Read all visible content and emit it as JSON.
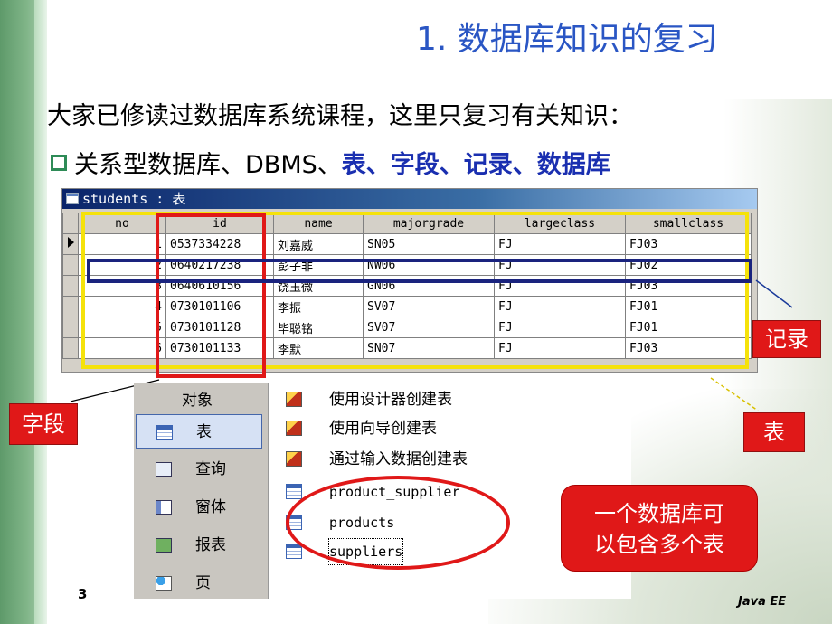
{
  "slide": {
    "title": "1. 数据库知识的复习",
    "intro": "大家已修读过数据库系统课程，这里只复习有关知识：",
    "bullet_plain": "关系型数据库、DBMS、",
    "bullet_highlight": "表、字段、记录、数据库",
    "page_number": "3",
    "footer": "Java EE"
  },
  "table_window": {
    "title": "students : 表",
    "columns": [
      "no",
      "id",
      "name",
      "majorgrade",
      "largeclass",
      "smallclass"
    ],
    "rows": [
      [
        "1",
        "0537334228",
        "刘嘉威",
        "SN05",
        "FJ",
        "FJ03"
      ],
      [
        "2",
        "0640217238",
        "彭子非",
        "NW06",
        "FJ",
        "FJ02"
      ],
      [
        "3",
        "0640610156",
        "饶玉微",
        "GN06",
        "FJ",
        "FJ03"
      ],
      [
        "4",
        "0730101106",
        "李振",
        "SV07",
        "FJ",
        "FJ01"
      ],
      [
        "5",
        "0730101128",
        "毕聪铭",
        "SV07",
        "FJ",
        "FJ01"
      ],
      [
        "6",
        "0730101133",
        "李默",
        "SN07",
        "FJ",
        "FJ03"
      ]
    ]
  },
  "labels": {
    "record": "记录",
    "field": "字段",
    "table": "表"
  },
  "access_panel": {
    "objects_header": "对象",
    "objects": [
      {
        "label": "表",
        "icon": "table-icon"
      },
      {
        "label": "查询",
        "icon": "query-icon"
      },
      {
        "label": "窗体",
        "icon": "form-icon"
      },
      {
        "label": "报表",
        "icon": "report-icon"
      },
      {
        "label": "页",
        "icon": "page-icon"
      }
    ],
    "list": [
      {
        "label": "使用设计器创建表",
        "icon": "wizard-icon"
      },
      {
        "label": "使用向导创建表",
        "icon": "wizard-icon"
      },
      {
        "label": "通过输入数据创建表",
        "icon": "wizard-icon"
      },
      {
        "label": "product_supplier",
        "icon": "table-icon"
      },
      {
        "label": "products",
        "icon": "table-icon"
      },
      {
        "label": "suppliers",
        "icon": "table-icon"
      }
    ]
  },
  "callout": {
    "line1": "一个数据库可",
    "line2": "以包含多个表"
  },
  "colors": {
    "title": "#2a56c4",
    "highlight": "#1a2fb0",
    "red": "#e01818",
    "yellow": "#f5e20a",
    "navy": "#1a237e",
    "green_bar": "#6fa879"
  }
}
